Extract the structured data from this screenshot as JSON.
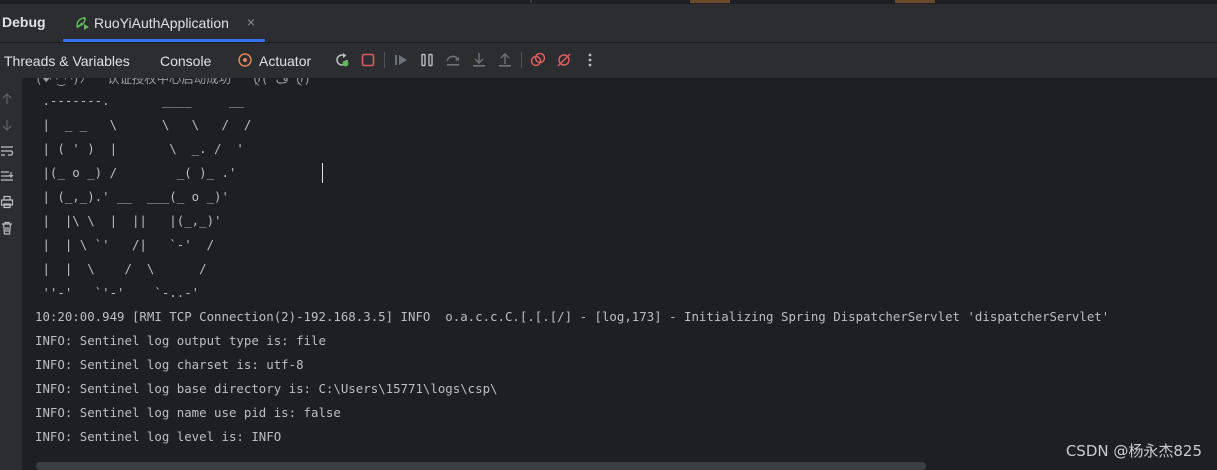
{
  "tool_window": {
    "title": "Debug",
    "run_tab": {
      "label": "RuoYiAuthApplication",
      "icon": "spring-boot-run-icon",
      "close_icon": "close-icon"
    }
  },
  "toolbar": {
    "threads_label": "Threads & Variables",
    "console_label": "Console",
    "actuator_label": "Actuator",
    "icons": [
      "rerun-icon",
      "stop-icon",
      "resume-icon",
      "pause-icon",
      "step-over-icon",
      "step-into-icon",
      "step-out-icon",
      "view-breakpoints-icon",
      "mute-breakpoints-icon",
      "more-options-icon"
    ]
  },
  "gutter_icons": [
    "up-arrow-icon",
    "down-arrow-icon",
    "soft-wrap-icon",
    "scroll-to-end-icon",
    "print-icon",
    "clear-all-icon"
  ],
  "console": {
    "banner_partial": "(♥◠‿◠)ﾉﾞ  认证授权中心启动成功   ლ(´ڡ`ლ)ﾞ",
    "banner": [
      " .-------.       ____     __",
      " |  _ _   \\      \\   \\   /  /",
      " | ( ' )  |       \\  _. /  '",
      " |(_ o _) /        _( )_ .'",
      " | (_,_).' __  ___(_ o _)'",
      " |  |\\ \\  |  ||   |(_,_)'",
      " |  | \\ `'   /|   `-'  /",
      " |  |  \\    /  \\      /",
      " ''-'   `'-'    `-..-'"
    ],
    "log_lines": [
      "10:20:00.949 [RMI TCP Connection(2)-192.168.3.5] INFO  o.a.c.c.C.[.[.[/] - [log,173] - Initializing Spring DispatcherServlet 'dispatcherServlet'",
      "INFO: Sentinel log output type is: file",
      "INFO: Sentinel log charset is: utf-8",
      "INFO: Sentinel log base directory is: C:\\Users\\15771\\logs\\csp\\",
      "INFO: Sentinel log name use pid is: false",
      "INFO: Sentinel log level is: INFO"
    ]
  },
  "watermark": "CSDN @杨永杰825",
  "colors": {
    "background": "#1e1f22",
    "panel": "#2b2d30",
    "accent": "#3574f0",
    "text": "#bcbec4",
    "stop": "#db5c5c",
    "actuator": "#e08855",
    "spring_green": "#5fb85b"
  }
}
